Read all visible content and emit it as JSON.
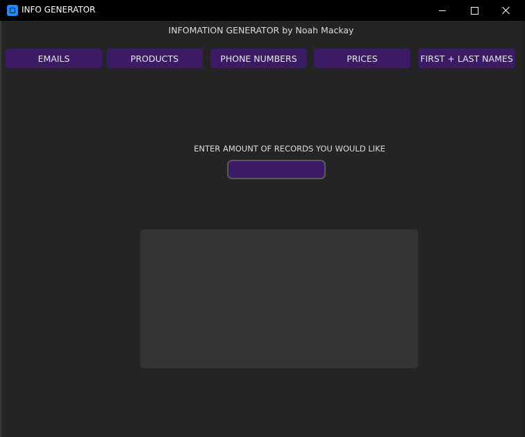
{
  "window": {
    "title": "INFO GENERATOR",
    "controls": {
      "minimize_icon": "minimize-icon",
      "maximize_icon": "maximize-icon",
      "close_icon": "close-icon"
    }
  },
  "header": {
    "heading": "INFOMATION GENERATOR by Noah Mackay"
  },
  "tabs": [
    {
      "label": "EMAILS"
    },
    {
      "label": "PRODUCTS"
    },
    {
      "label": "PHONE NUMBERS"
    },
    {
      "label": "PRICES"
    },
    {
      "label": "FIRST + LAST NAMES"
    }
  ],
  "records": {
    "label": "ENTER AMOUNT OF RECORDS YOU WOULD LIKE",
    "value": "",
    "placeholder": ""
  },
  "output": {
    "text": ""
  },
  "colors": {
    "accent": "#3b1a66",
    "background": "#242424",
    "titlebar": "#000000",
    "output_box": "#333333",
    "app_icon": "#1a8cff"
  }
}
